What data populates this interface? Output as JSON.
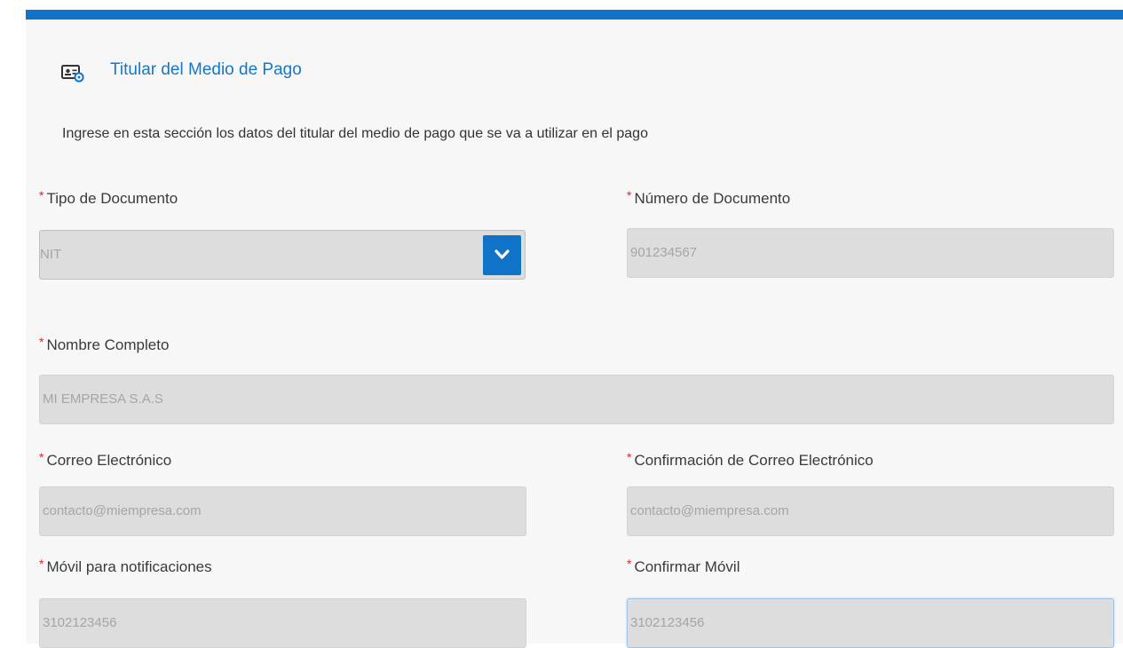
{
  "section": {
    "title": "Titular del Medio de Pago",
    "description": "Ingrese en esta sección los datos del titular del medio de pago que se va a utilizar en el pago",
    "icon": "id-card-icon"
  },
  "required_marker": "*",
  "colors": {
    "accent": "#0f73c8",
    "title": "#1677c9",
    "required": "#d7282f",
    "field_bg": "#dddddd"
  },
  "fields": {
    "tipo_documento": {
      "label": "Tipo de Documento",
      "value": "NIT"
    },
    "numero_documento": {
      "label": "Número de Documento",
      "value": "901234567"
    },
    "nombre_completo": {
      "label": "Nombre Completo",
      "value": "MI EMPRESA S.A.S"
    },
    "correo": {
      "label": "Correo Electrónico",
      "value": "contacto@miempresa.com"
    },
    "confirmacion_correo": {
      "label": "Confirmación de Correo Electrónico",
      "value": "contacto@miempresa.com"
    },
    "movil": {
      "label": "Móvil para notificaciones",
      "value": "3102123456"
    },
    "confirmar_movil": {
      "label": "Confirmar Móvil",
      "value": "3102123456"
    }
  }
}
